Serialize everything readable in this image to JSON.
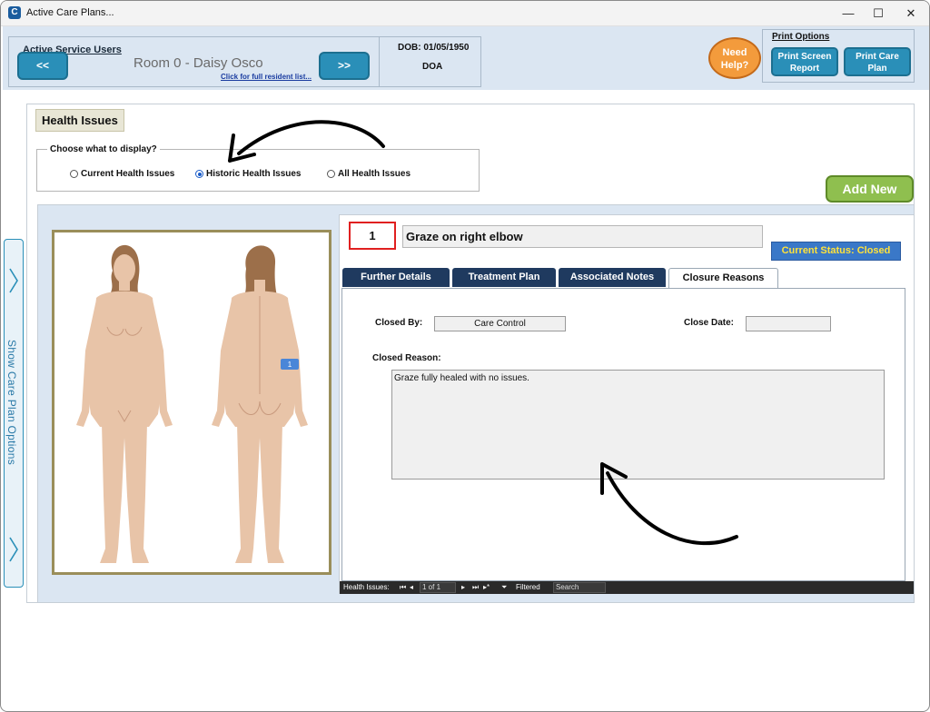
{
  "window": {
    "title": "Active Care Plans...",
    "minimize_glyph": "—",
    "maximize_glyph": "☐",
    "close_glyph": "✕"
  },
  "header": {
    "active_service_users_label": "Active Service Users",
    "prev_label": "<<",
    "next_label": ">>",
    "room_resident": "Room 0 - Daisy Osco",
    "full_list_link": "Click for full resident list...",
    "dob": "DOB: 01/05/1950",
    "doa": "DOA",
    "help_line1": "Need",
    "help_line2": "Help?",
    "print_options_label": "Print Options",
    "print_screen_line1": "Print Screen",
    "print_screen_line2": "Report",
    "print_care_line1": "Print Care",
    "print_care_line2": "Plan"
  },
  "side": {
    "label": "Show Care Plan Options"
  },
  "main": {
    "section_title": "Health Issues",
    "choose_label": "Choose what to display?",
    "radios": [
      {
        "label": "Current Health Issues",
        "selected": false
      },
      {
        "label": "Historic Health Issues",
        "selected": true
      },
      {
        "label": "All Health Issues",
        "selected": false
      }
    ],
    "add_new_label": "Add New"
  },
  "body_map": {
    "marker_label": "1"
  },
  "issue": {
    "number": "1",
    "title": "Graze on right elbow",
    "status": "Current Status: Closed"
  },
  "tabs": [
    {
      "label": "Further Details",
      "active": false
    },
    {
      "label": "Treatment Plan",
      "active": false
    },
    {
      "label": "Associated Notes",
      "active": false
    },
    {
      "label": "Closure Reasons",
      "active": true
    }
  ],
  "closure": {
    "closed_by_label": "Closed By:",
    "closed_by_value": "Care Control",
    "close_date_label": "Close Date:",
    "close_date_value": "",
    "closed_reason_label": "Closed Reason:",
    "closed_reason_value": "Graze fully healed with no issues."
  },
  "record_nav": {
    "label": "Health Issues:",
    "position": "1 of 1",
    "filter_label": "Filtered",
    "search_label": "Search"
  },
  "colors": {
    "nav_button": "#2a8fb8",
    "help_button": "#f39b3c",
    "add_new": "#8fbf4f",
    "status_bg": "#3a78c8",
    "status_text": "#ffe23a",
    "tab_bg": "#1f3a5f"
  }
}
